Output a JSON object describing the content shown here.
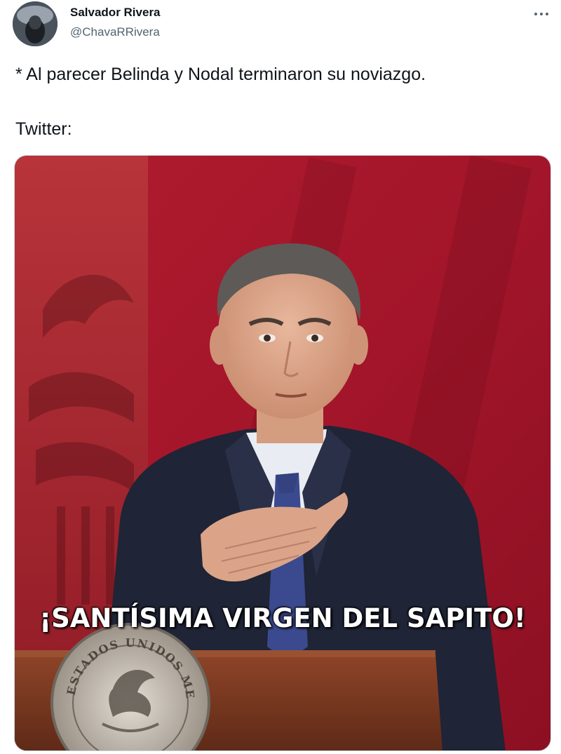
{
  "tweet": {
    "author": {
      "display_name": "Salvador Rivera",
      "handle": "@ChavaRRivera",
      "avatar_icon": "profile-avatar"
    },
    "more_icon": "more-horizontal-icon",
    "text_lines": [
      "* Al parecer Belinda y Nodal terminaron su noviazgo.",
      "Twitter:"
    ],
    "media": {
      "caption": "¡SANTÍSIMA VIRGEN DEL SAPITO!",
      "seal_text": "ESTADOS UNIDOS MEXICANOS"
    }
  },
  "colors": {
    "text": "#0f1419",
    "secondary_text": "#536471",
    "backdrop_red": "#a8162a",
    "suit_navy": "#1e2336",
    "podium_wood": "#7a3a24"
  }
}
